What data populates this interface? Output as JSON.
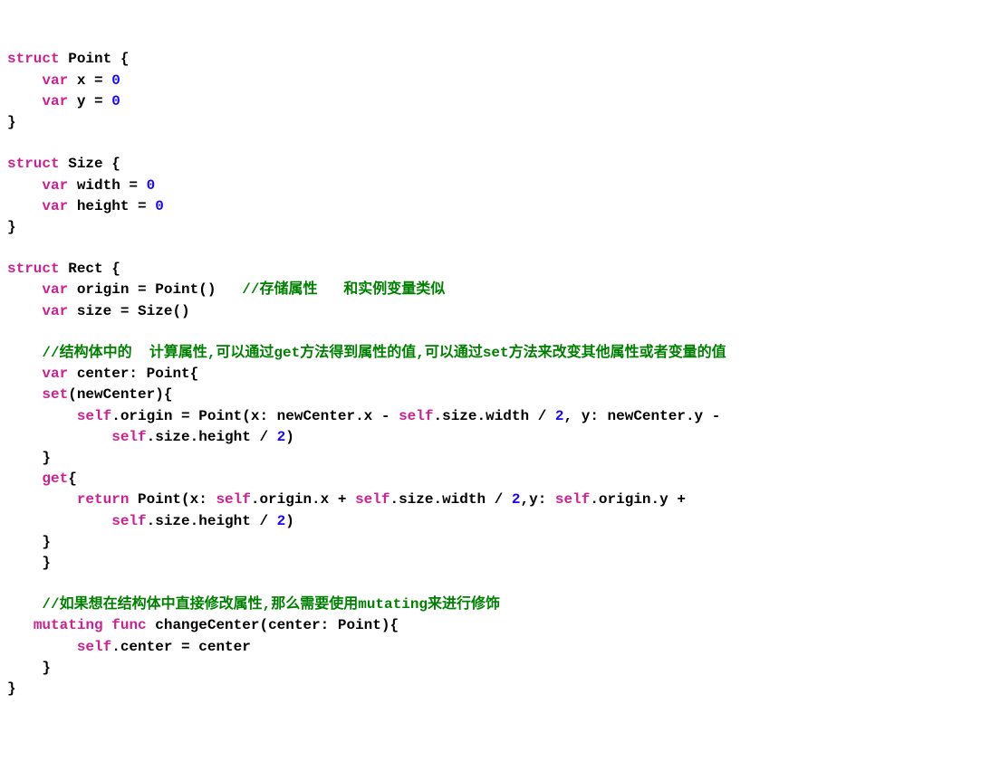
{
  "code": {
    "l1_kw1": "struct",
    "l1_id1": " Point {",
    "l2_kw1": "    var",
    "l2_id1": " x = ",
    "l2_num1": "0",
    "l3_kw1": "    var",
    "l3_id1": " y = ",
    "l3_num1": "0",
    "l4": "}",
    "l5": "",
    "l6_kw1": "struct",
    "l6_id1": " Size {",
    "l7_kw1": "    var",
    "l7_id1": " width = ",
    "l7_num1": "0",
    "l8_kw1": "    var",
    "l8_id1": " height = ",
    "l8_num1": "0",
    "l9": "}",
    "l10": "",
    "l11_kw1": "struct",
    "l11_id1": " Rect {",
    "l12_kw1": "    var",
    "l12_id1": " origin = Point()   ",
    "l12_cmt": "//存储属性   和实例变量类似",
    "l13_kw1": "    var",
    "l13_id1": " size = Size()",
    "l14": "    ",
    "l15_cmt": "    //结构体中的  计算属性,可以通过get方法得到属性的值,可以通过set方法来改变其他属性或者变量的值",
    "l16_kw1": "    var",
    "l16_id1": " center: Point{",
    "l17_kw1": "    set",
    "l17_id1": "(newCenter){",
    "l18a": "        ",
    "l18_kw1": "self",
    "l18b": ".origin = Point(x: newCenter.x - ",
    "l18_kw2": "self",
    "l18c": ".size.width / ",
    "l18_num1": "2",
    "l18d": ", y: newCenter.y -",
    "l19a": "            ",
    "l19_kw1": "self",
    "l19b": ".size.height / ",
    "l19_num1": "2",
    "l19c": ")",
    "l20": "    }",
    "l21_kw1": "    get",
    "l21_id1": "{",
    "l22a": "        ",
    "l22_kw1": "return",
    "l22b": " Point(x: ",
    "l22_kw2": "self",
    "l22c": ".origin.x + ",
    "l22_kw3": "self",
    "l22d": ".size.width / ",
    "l22_num1": "2",
    "l22e": ",y: ",
    "l22_kw4": "self",
    "l22f": ".origin.y +",
    "l23a": "            ",
    "l23_kw1": "self",
    "l23b": ".size.height / ",
    "l23_num1": "2",
    "l23c": ")",
    "l24": "    }",
    "l25": "    }",
    "l26": "    ",
    "l27_cmt": "    //如果想在结构体中直接修改属性,那么需要使用mutating来进行修饰",
    "l28a": "   ",
    "l28_kw1": "mutating",
    "l28b": " ",
    "l28_kw2": "func",
    "l28c": " changeCenter(center: Point){",
    "l29a": "        ",
    "l29_kw1": "self",
    "l29b": ".center = center",
    "l30": "    }",
    "l31": "}"
  }
}
